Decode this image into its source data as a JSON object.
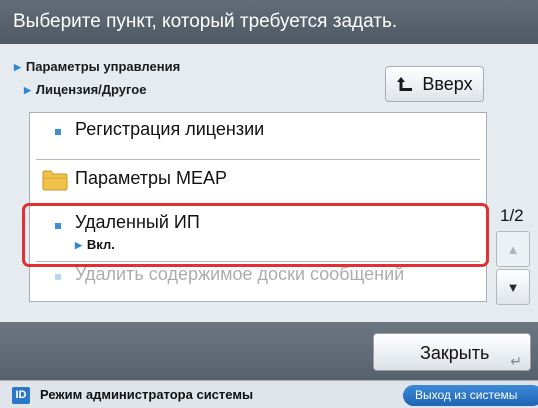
{
  "header": {
    "title": "Выберите пункт, который требуется задать."
  },
  "breadcrumb": {
    "level1": "Параметры управления",
    "level2": "Лицензия/Другое"
  },
  "up_button": {
    "label": "Вверх"
  },
  "list": {
    "items": [
      {
        "label": "Регистрация лицензии"
      },
      {
        "label": "Параметры MEAP"
      },
      {
        "label": "Удаленный ИП",
        "value": "Вкл."
      },
      {
        "label": "Удалить содержимое доски сообщений"
      }
    ]
  },
  "page_indicator": "1/2",
  "close_button": {
    "label": "Закрыть"
  },
  "status_bar": {
    "mode_text": "Режим администратора системы",
    "logout_label": "Выход из системы",
    "id_icon": "ID"
  }
}
